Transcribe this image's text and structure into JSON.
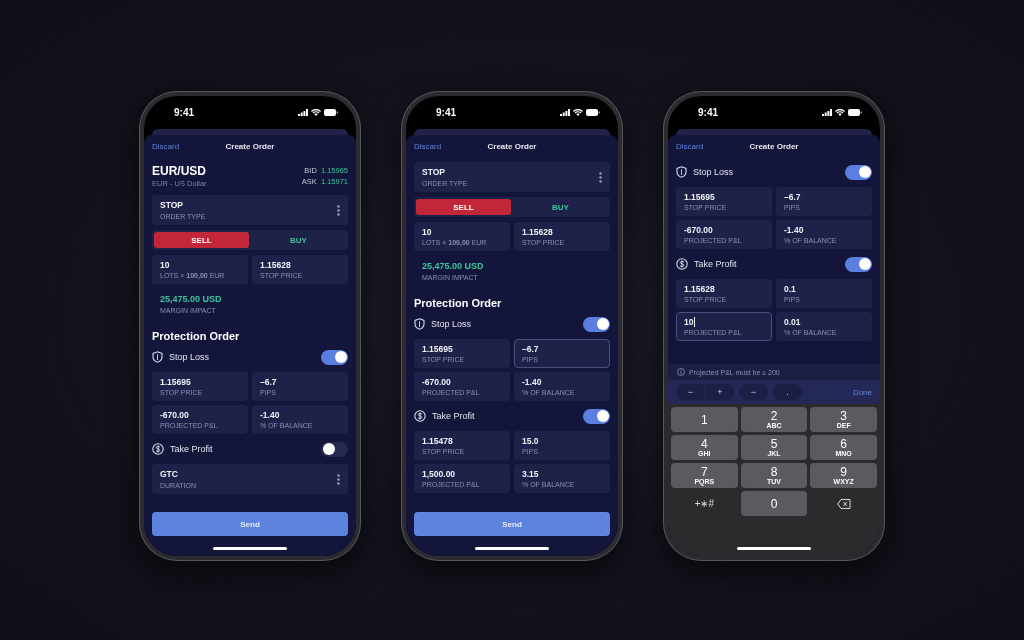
{
  "phones": [
    {
      "time": "9:41",
      "discard": "Discard",
      "title": "Create Order",
      "blocks": [
        {
          "kind": "pair",
          "symbol": "EUR/USD",
          "name": "EUR - US Dollar",
          "quotes": [
            {
              "label": "BID",
              "value": "1.15965"
            },
            {
              "label": "ASK",
              "value": "1.15971"
            }
          ]
        },
        {
          "kind": "select",
          "value": "STOP",
          "label": "ORDER TYPE"
        },
        {
          "kind": "side",
          "options": [
            {
              "label": "SELL",
              "selected": true,
              "color": "#c22639"
            },
            {
              "label": "BUY",
              "selected": false,
              "color": "#3cc49b"
            }
          ]
        },
        {
          "kind": "fields",
          "cells": [
            {
              "value": "10",
              "label": "LOTS × **100,00** EUR",
              "focused": false,
              "cursor": false
            },
            {
              "value": "1.15628",
              "label": "STOP PRICE",
              "focused": false,
              "cursor": false
            }
          ]
        },
        {
          "kind": "stat",
          "value": "25,475.00 USD",
          "label": "MARGIN IMPACT"
        },
        {
          "kind": "heading",
          "text": "Protection Order"
        },
        {
          "kind": "toggle",
          "label": "Stop Loss",
          "on": true
        },
        {
          "kind": "fields",
          "cells": [
            {
              "value": "1.15695",
              "label": "STOP PRICE",
              "focused": false,
              "cursor": false
            },
            {
              "value": "–6.7",
              "label": "PIPS",
              "focused": false,
              "cursor": false
            },
            {
              "value": "-670.00",
              "label": "PROJECTED P&L",
              "focused": false,
              "cursor": false
            },
            {
              "value": "-1.40",
              "label": "% OF BALANCE",
              "focused": false,
              "cursor": false
            }
          ]
        },
        {
          "kind": "toggle",
          "label": "Take Profit",
          "on": false
        },
        {
          "kind": "select",
          "value": "GTC",
          "label": "DURATION"
        },
        {
          "kind": "send",
          "label": "Send"
        }
      ]
    },
    {
      "time": "9:41",
      "discard": "Discard",
      "title": "Create Order",
      "blocks": [
        {
          "kind": "select",
          "value": "STOP",
          "label": "ORDER TYPE"
        },
        {
          "kind": "side",
          "options": [
            {
              "label": "SELL",
              "selected": true,
              "color": "#c22639"
            },
            {
              "label": "BUY",
              "selected": false,
              "color": "#3cc49b"
            }
          ]
        },
        {
          "kind": "fields",
          "cells": [
            {
              "value": "10",
              "label": "LOTS × **100,00** EUR",
              "focused": false,
              "cursor": false
            },
            {
              "value": "1.15628",
              "label": "STOP PRICE",
              "focused": false,
              "cursor": false
            }
          ]
        },
        {
          "kind": "stat",
          "value": "25,475.00 USD",
          "label": "MARGIN IMPACT"
        },
        {
          "kind": "heading",
          "text": "Protection Order"
        },
        {
          "kind": "toggle",
          "label": "Stop Loss",
          "on": true
        },
        {
          "kind": "fields",
          "cells": [
            {
              "value": "1.15695",
              "label": "STOP PRICE",
              "focused": false,
              "cursor": false
            },
            {
              "value": "–6.7",
              "label": "PIPS",
              "focused": true,
              "cursor": false
            },
            {
              "value": "-670.00",
              "label": "PROJECTED P&L",
              "focused": false,
              "cursor": false
            },
            {
              "value": "-1.40",
              "label": "% OF BALANCE",
              "focused": false,
              "cursor": false
            }
          ]
        },
        {
          "kind": "toggle",
          "label": "Take Profit",
          "on": true
        },
        {
          "kind": "fields",
          "cells": [
            {
              "value": "1.15478",
              "label": "STOP PRICE",
              "focused": false,
              "cursor": false
            },
            {
              "value": "15.0",
              "label": "PIPS",
              "focused": false,
              "cursor": false
            },
            {
              "value": "1,500.00",
              "label": "PROJECTED P&L",
              "focused": false,
              "cursor": false
            },
            {
              "value": "3.15",
              "label": "% OF BALANCE",
              "focused": false,
              "cursor": false
            }
          ]
        },
        {
          "kind": "send",
          "label": "Send"
        }
      ]
    },
    {
      "time": "9:41",
      "discard": "Discard",
      "title": "Create Order",
      "blocks": [
        {
          "kind": "toggle",
          "label": "Stop Loss",
          "on": true
        },
        {
          "kind": "fields",
          "cells": [
            {
              "value": "1.15695",
              "label": "STOP PRICE",
              "focused": false,
              "cursor": false
            },
            {
              "value": "–6.7",
              "label": "PIPS",
              "focused": false,
              "cursor": false
            },
            {
              "value": "-670.00",
              "label": "PROJECTED P&L",
              "focused": false,
              "cursor": false
            },
            {
              "value": "-1.40",
              "label": "% OF BALANCE",
              "focused": false,
              "cursor": false
            }
          ]
        },
        {
          "kind": "toggle",
          "label": "Take Profit",
          "on": true
        },
        {
          "kind": "fields",
          "cells": [
            {
              "value": "1.15628",
              "label": "STOP PRICE",
              "focused": false,
              "cursor": false
            },
            {
              "value": "0.1",
              "label": "PIPS",
              "focused": false,
              "cursor": false
            },
            {
              "value": "10",
              "label": "PROJECTED P&L",
              "focused": true,
              "cursor": true
            },
            {
              "value": "0.01",
              "label": "% OF BALANCE",
              "focused": false,
              "cursor": false
            }
          ]
        },
        {
          "kind": "keyboard",
          "hint": "Projected P&L must be ≥ 200",
          "stepper": [
            "−",
            "+"
          ],
          "keys": [
            "−",
            "."
          ],
          "done": "Done",
          "pad": [
            {
              "kind": "digit",
              "digit": "1"
            },
            {
              "kind": "digit",
              "digit": "2",
              "letters": "ABC"
            },
            {
              "kind": "digit",
              "digit": "3",
              "letters": "DEF"
            },
            {
              "kind": "digit",
              "digit": "4",
              "letters": "GHI"
            },
            {
              "kind": "digit",
              "digit": "5",
              "letters": "JKL"
            },
            {
              "kind": "digit",
              "digit": "6",
              "letters": "MNO"
            },
            {
              "kind": "digit",
              "digit": "7",
              "letters": "PQRS"
            },
            {
              "kind": "digit",
              "digit": "8",
              "letters": "TUV"
            },
            {
              "kind": "digit",
              "digit": "9",
              "letters": "WXYZ"
            },
            {
              "kind": "symbols",
              "label": "+∗#"
            },
            {
              "kind": "digit",
              "digit": "0"
            },
            {
              "kind": "delete"
            }
          ]
        }
      ]
    }
  ]
}
